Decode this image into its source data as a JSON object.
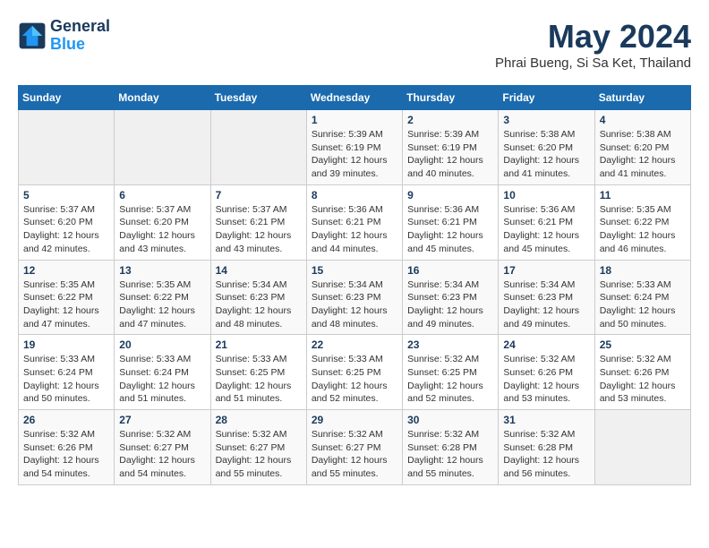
{
  "logo": {
    "line1": "General",
    "line2": "Blue"
  },
  "title": "May 2024",
  "location": "Phrai Bueng, Si Sa Ket, Thailand",
  "days_header": [
    "Sunday",
    "Monday",
    "Tuesday",
    "Wednesday",
    "Thursday",
    "Friday",
    "Saturday"
  ],
  "weeks": [
    [
      {
        "num": "",
        "info": ""
      },
      {
        "num": "",
        "info": ""
      },
      {
        "num": "",
        "info": ""
      },
      {
        "num": "1",
        "info": "Sunrise: 5:39 AM\nSunset: 6:19 PM\nDaylight: 12 hours\nand 39 minutes."
      },
      {
        "num": "2",
        "info": "Sunrise: 5:39 AM\nSunset: 6:19 PM\nDaylight: 12 hours\nand 40 minutes."
      },
      {
        "num": "3",
        "info": "Sunrise: 5:38 AM\nSunset: 6:20 PM\nDaylight: 12 hours\nand 41 minutes."
      },
      {
        "num": "4",
        "info": "Sunrise: 5:38 AM\nSunset: 6:20 PM\nDaylight: 12 hours\nand 41 minutes."
      }
    ],
    [
      {
        "num": "5",
        "info": "Sunrise: 5:37 AM\nSunset: 6:20 PM\nDaylight: 12 hours\nand 42 minutes."
      },
      {
        "num": "6",
        "info": "Sunrise: 5:37 AM\nSunset: 6:20 PM\nDaylight: 12 hours\nand 43 minutes."
      },
      {
        "num": "7",
        "info": "Sunrise: 5:37 AM\nSunset: 6:21 PM\nDaylight: 12 hours\nand 43 minutes."
      },
      {
        "num": "8",
        "info": "Sunrise: 5:36 AM\nSunset: 6:21 PM\nDaylight: 12 hours\nand 44 minutes."
      },
      {
        "num": "9",
        "info": "Sunrise: 5:36 AM\nSunset: 6:21 PM\nDaylight: 12 hours\nand 45 minutes."
      },
      {
        "num": "10",
        "info": "Sunrise: 5:36 AM\nSunset: 6:21 PM\nDaylight: 12 hours\nand 45 minutes."
      },
      {
        "num": "11",
        "info": "Sunrise: 5:35 AM\nSunset: 6:22 PM\nDaylight: 12 hours\nand 46 minutes."
      }
    ],
    [
      {
        "num": "12",
        "info": "Sunrise: 5:35 AM\nSunset: 6:22 PM\nDaylight: 12 hours\nand 47 minutes."
      },
      {
        "num": "13",
        "info": "Sunrise: 5:35 AM\nSunset: 6:22 PM\nDaylight: 12 hours\nand 47 minutes."
      },
      {
        "num": "14",
        "info": "Sunrise: 5:34 AM\nSunset: 6:23 PM\nDaylight: 12 hours\nand 48 minutes."
      },
      {
        "num": "15",
        "info": "Sunrise: 5:34 AM\nSunset: 6:23 PM\nDaylight: 12 hours\nand 48 minutes."
      },
      {
        "num": "16",
        "info": "Sunrise: 5:34 AM\nSunset: 6:23 PM\nDaylight: 12 hours\nand 49 minutes."
      },
      {
        "num": "17",
        "info": "Sunrise: 5:34 AM\nSunset: 6:23 PM\nDaylight: 12 hours\nand 49 minutes."
      },
      {
        "num": "18",
        "info": "Sunrise: 5:33 AM\nSunset: 6:24 PM\nDaylight: 12 hours\nand 50 minutes."
      }
    ],
    [
      {
        "num": "19",
        "info": "Sunrise: 5:33 AM\nSunset: 6:24 PM\nDaylight: 12 hours\nand 50 minutes."
      },
      {
        "num": "20",
        "info": "Sunrise: 5:33 AM\nSunset: 6:24 PM\nDaylight: 12 hours\nand 51 minutes."
      },
      {
        "num": "21",
        "info": "Sunrise: 5:33 AM\nSunset: 6:25 PM\nDaylight: 12 hours\nand 51 minutes."
      },
      {
        "num": "22",
        "info": "Sunrise: 5:33 AM\nSunset: 6:25 PM\nDaylight: 12 hours\nand 52 minutes."
      },
      {
        "num": "23",
        "info": "Sunrise: 5:32 AM\nSunset: 6:25 PM\nDaylight: 12 hours\nand 52 minutes."
      },
      {
        "num": "24",
        "info": "Sunrise: 5:32 AM\nSunset: 6:26 PM\nDaylight: 12 hours\nand 53 minutes."
      },
      {
        "num": "25",
        "info": "Sunrise: 5:32 AM\nSunset: 6:26 PM\nDaylight: 12 hours\nand 53 minutes."
      }
    ],
    [
      {
        "num": "26",
        "info": "Sunrise: 5:32 AM\nSunset: 6:26 PM\nDaylight: 12 hours\nand 54 minutes."
      },
      {
        "num": "27",
        "info": "Sunrise: 5:32 AM\nSunset: 6:27 PM\nDaylight: 12 hours\nand 54 minutes."
      },
      {
        "num": "28",
        "info": "Sunrise: 5:32 AM\nSunset: 6:27 PM\nDaylight: 12 hours\nand 55 minutes."
      },
      {
        "num": "29",
        "info": "Sunrise: 5:32 AM\nSunset: 6:27 PM\nDaylight: 12 hours\nand 55 minutes."
      },
      {
        "num": "30",
        "info": "Sunrise: 5:32 AM\nSunset: 6:28 PM\nDaylight: 12 hours\nand 55 minutes."
      },
      {
        "num": "31",
        "info": "Sunrise: 5:32 AM\nSunset: 6:28 PM\nDaylight: 12 hours\nand 56 minutes."
      },
      {
        "num": "",
        "info": ""
      }
    ]
  ]
}
